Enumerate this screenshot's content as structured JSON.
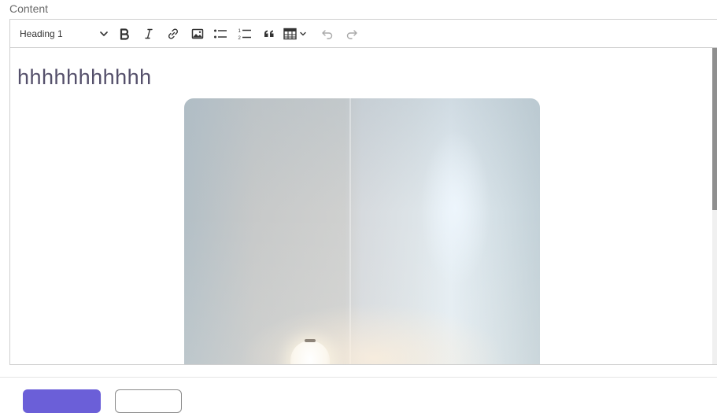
{
  "field": {
    "label": "Content"
  },
  "toolbar": {
    "heading_select": {
      "value": "Heading 1"
    },
    "buttons": [
      {
        "name": "bold",
        "icon": "bold-icon"
      },
      {
        "name": "italic",
        "icon": "italic-icon"
      },
      {
        "name": "link",
        "icon": "link-icon"
      },
      {
        "name": "image",
        "icon": "image-icon"
      },
      {
        "name": "bulleted-list",
        "icon": "bulleted-list-icon"
      },
      {
        "name": "numbered-list",
        "icon": "numbered-list-icon"
      },
      {
        "name": "blockquote",
        "icon": "quote-icon"
      },
      {
        "name": "insert-table",
        "icon": "table-icon"
      },
      {
        "name": "undo",
        "icon": "undo-icon"
      },
      {
        "name": "redo",
        "icon": "redo-icon"
      }
    ]
  },
  "content": {
    "heading": "hhhhhhhhhhh",
    "image": {
      "description_icon": "photo-of-white-wall-with-lamp"
    }
  },
  "colors": {
    "primary_button": "#6b5fd8",
    "heading_text": "#55506b",
    "border": "#cfcfcf"
  }
}
